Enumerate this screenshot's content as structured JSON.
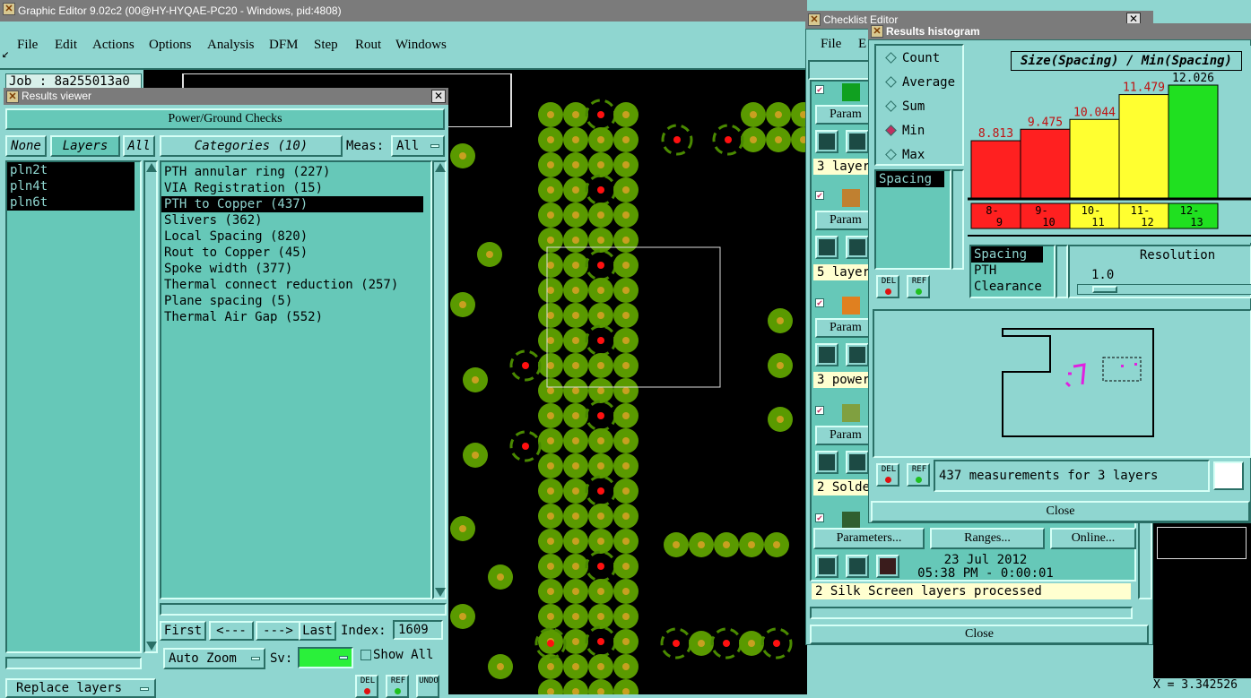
{
  "main_window": {
    "title": "Graphic Editor 9.02c2 (00@HY-HYQAE-PC20 - Windows, pid:4808)",
    "menu": [
      "File",
      "Edit",
      "Actions",
      "Options",
      "Analysis",
      "DFM",
      "Step",
      "Rout",
      "Windows"
    ],
    "job_label": "Job : 8a255013a0"
  },
  "results_viewer": {
    "title": "Results viewer",
    "header": "Power/Ground Checks",
    "filter_none": "None",
    "filter_layers": "Layers",
    "filter_all": "All",
    "categories_label": "Categories (10)",
    "meas_label": "Meas:",
    "meas_value": "All",
    "layers": [
      "pln2t",
      "pln4t",
      "pln6t"
    ],
    "categories": [
      "PTH annular ring (227)",
      "VIA Registration (15)",
      "PTH to Copper (437)",
      "Slivers (362)",
      "Local Spacing (820)",
      "Rout to Copper (45)",
      "Spoke width (377)",
      "Thermal connect reduction (257)",
      "Plane spacing (5)",
      "Thermal Air Gap (552)"
    ],
    "selected_category": 2,
    "nav_first": "First",
    "nav_prev": "<---",
    "nav_next": "--->",
    "nav_last": "Last",
    "index_label": "Index:",
    "index_value": "1609",
    "auto_zoom": "Auto Zoom",
    "sv_label": "Sv:",
    "show_all": "Show All",
    "replace_layers": "Replace layers",
    "del_label": "DEL",
    "ref_label": "REF",
    "undo_label": "UNDO"
  },
  "checklist_editor": {
    "title": "Checklist Editor",
    "menu": [
      "File",
      "E"
    ],
    "param_label": "Param",
    "rows": [
      "3 layer",
      "5 layer",
      "3 power",
      "2 Solde"
    ],
    "btn_parameters": "Parameters...",
    "btn_ranges": "Ranges...",
    "btn_online": "Online...",
    "date": "23 Jul 2012",
    "time": "05:38 PM - 0:00:01",
    "status": "2 Silk Screen layers processed",
    "close": "Close"
  },
  "histogram": {
    "title": "Results histogram",
    "modes": [
      "Count",
      "Average",
      "Sum",
      "Min",
      "Max"
    ],
    "selected_mode": 3,
    "list_item": "Spacing",
    "chart_title": "Size(Spacing) / Min(Spacing)",
    "spacing_list": [
      "Spacing",
      "PTH",
      "Clearance"
    ],
    "resolution_label": "Resolution",
    "resolution_value": "1.0",
    "status": "437 measurements for 3 layers",
    "close": "Close",
    "del_label": "DEL",
    "ref_label": "REF",
    "bar_colors": [
      "#ff2020",
      "#ff2020",
      "#ffff30",
      "#ffff30",
      "#20e020"
    ]
  },
  "chart_data": {
    "type": "bar",
    "title": "Size(Spacing) / Min(Spacing)",
    "categories": [
      "8-9",
      "9-10",
      "10-11",
      "11-12",
      "12-13"
    ],
    "values": [
      8.813,
      9.475,
      10.044,
      11.479,
      12.026
    ],
    "ylim": [
      0,
      12.026
    ]
  },
  "coord_readout": "X = 3.342526"
}
